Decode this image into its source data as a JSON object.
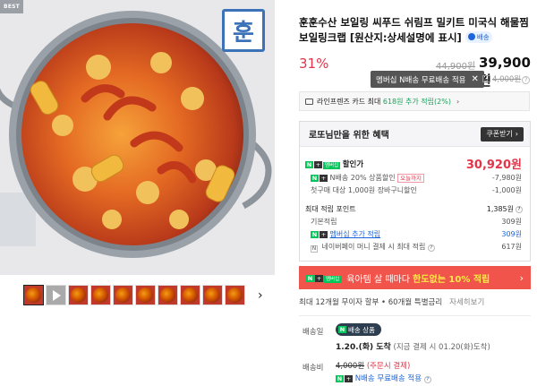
{
  "gallery": {
    "best_badge": "BEST",
    "brand_logo_text": "훈",
    "main_image_alt": "해물찜 보일링크랩",
    "thumbnails": [
      "photo",
      "video",
      "photo",
      "photo",
      "photo",
      "photo",
      "photo",
      "photo",
      "photo",
      "photo"
    ],
    "next_icon": "›"
  },
  "product": {
    "title": "훈훈수산 보일링 씨푸드 쉬림프 밀키트 미국식 해물찜 보일링크랩 [원산지:상세설명에 표시]",
    "delivery_pill": "배송",
    "discount_rate": "31%",
    "original_price": "44,900원",
    "final_price": "39,900원",
    "tooltip_text": "멤버십 N배송 무료배송 적용",
    "tooltip_close": "✕",
    "member_fee": "4,000원",
    "card_benefit_prefix": "라인프렌즈 카드 최대 ",
    "card_benefit_highlight": "618원 추가 적립(2%)",
    "card_benefit_chev": "›"
  },
  "benefit": {
    "title": "로또님만을 위한 혜택",
    "coupon_button": "쿠폰받기",
    "coupon_chev": "›",
    "badge_n": "N",
    "badge_plus": "+",
    "badge_member": "멤버십",
    "discount_label": "할인가",
    "discount_price": "30,920원",
    "n_delivery_label": "N배송 20% 상품할인",
    "n_delivery_tag": "오늘까지",
    "n_delivery_value": "-7,980원",
    "first_purchase_label": "첫구매 대상 1,000원 장바구니할인",
    "first_purchase_value": "-1,000원",
    "points_label": "최대 적립 포인트",
    "points_value": "1,385원",
    "base_points_label": "기본적립",
    "base_points_value": "309원",
    "member_points_label": "멤버십 추가 적립",
    "member_points_value": "309원",
    "npay_points_label": "네이버페이 머니 결제 시 최대 적립",
    "npay_points_value": "617원"
  },
  "promo": {
    "label_prefix": "육아템 살 때마다 ",
    "label_highlight": "한도없는 10% 적립",
    "chev": "›"
  },
  "installment": {
    "text": "최대 12개월 무이자 할부 • 60개월 특별금리",
    "more": "자세히보기"
  },
  "shipping": {
    "label_day": "배송일",
    "badge": "배송 상품",
    "date_bold": "1.20.(화) 도착",
    "date_note": " (지금 결제 시 01.20(화)도착)",
    "label_fee": "배송비",
    "fee_strike": "4,000원",
    "fee_note": " (주문시 결제)",
    "fee_free": " N배송 무료배송 적용",
    "fee_q": "?"
  },
  "colors": {
    "accent_red": "#e2354a",
    "naver_green": "#03c75a",
    "promo_bg": "#f0544a",
    "brand_blue": "#3b72b8"
  }
}
